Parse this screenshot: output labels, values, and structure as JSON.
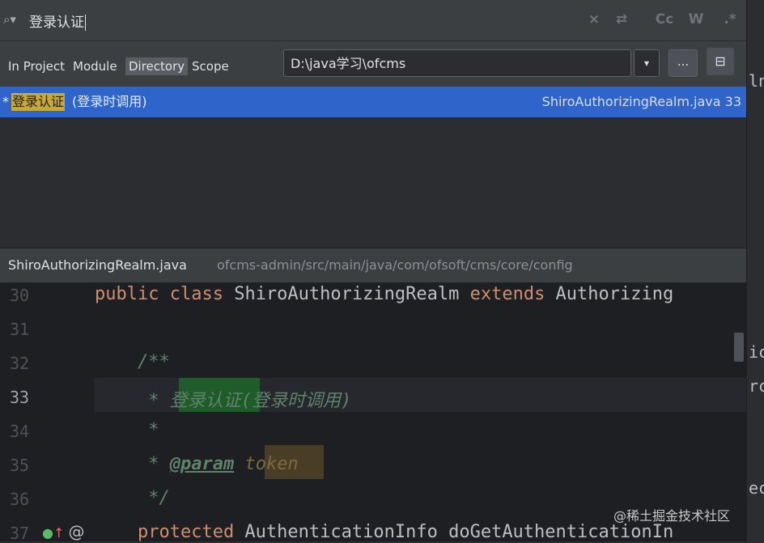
{
  "search": {
    "query": "登录认证",
    "icon": "search-icon",
    "tool_close": "×",
    "tool_replace": "⇄",
    "tool_case": "Cc",
    "tool_words": "W",
    "tool_regex": ".*"
  },
  "scopes": {
    "in_project": "In Project",
    "module": "Module",
    "directory": "Directory",
    "scope": "Scope"
  },
  "directory_field": {
    "value": "D:\\java学习\\ofcms",
    "dropdown_icon": "▾",
    "browse_label": "...",
    "tree_icon": "⊟"
  },
  "result": {
    "star": "*",
    "match": "登录认证",
    "rest": "(登录时调用)",
    "file": "ShiroAuthorizingRealm.java 33"
  },
  "preview": {
    "file": "ShiroAuthorizingRealm.java",
    "path": "ofcms-admin/src/main/java/com/ofsoft/cms/core/config"
  },
  "editor": {
    "lines": [
      {
        "num": "30"
      },
      {
        "num": "31"
      },
      {
        "num": "32"
      },
      {
        "num": "33"
      },
      {
        "num": "34"
      },
      {
        "num": "35"
      },
      {
        "num": "36"
      },
      {
        "num": "37"
      }
    ],
    "l30_kw": "public class",
    "l30_name": " ShiroAuthorizingRealm ",
    "l30_extends": "extends",
    "l30_parent": " Authorizing",
    "l32": "    /**",
    "l33_star": "     * ",
    "l33_match": "登录认证",
    "l33_rest": "(登录时调用)",
    "l34": "     *",
    "l35_star": "     * ",
    "l35_tag": "@param",
    "l35_arg": "token",
    "l36": "     */",
    "l37_kw": "    protected",
    "l37_rest": " AuthenticationInfo doGetAuthenticationIn"
  },
  "right_strip": {
    "t1": "ln",
    "t2": "ic",
    "t3": "rc",
    "t4": "ec"
  },
  "gutter": {
    "impl_icon": "implementation-icon",
    "up_icon": "override-up-icon",
    "at": "@"
  },
  "watermark": "@稀土掘金技术社区"
}
